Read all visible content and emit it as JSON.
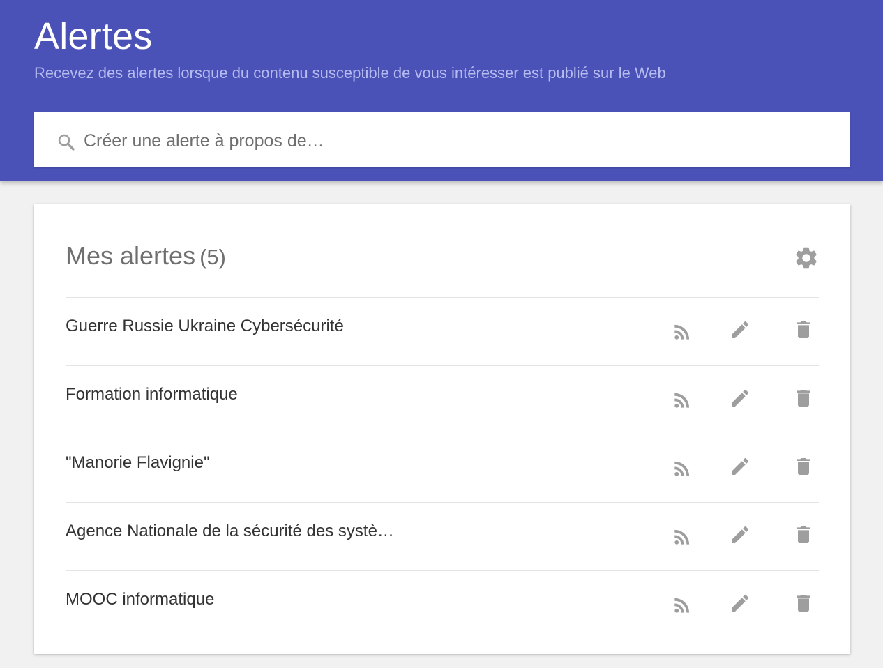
{
  "header": {
    "title": "Alertes",
    "subtitle": "Recevez des alertes lorsque du contenu susceptible de vous intéresser est publié sur le Web"
  },
  "search": {
    "icon": "search-icon",
    "placeholder": "Créer une alerte à propos de…"
  },
  "alerts_card": {
    "title": "Mes alertes",
    "count": "(5)",
    "settings_icon": "gear-icon",
    "items": [
      {
        "label": "Guerre Russie Ukraine Cybersécurité"
      },
      {
        "label": "Formation informatique"
      },
      {
        "label": "\"Manorie Flavignie\""
      },
      {
        "label": "Agence Nationale de la sécurité des systè…"
      },
      {
        "label": "MOOC informatique"
      }
    ],
    "row_icons": [
      "rss-icon",
      "edit-icon",
      "delete-icon"
    ]
  },
  "colors": {
    "header_bg": "#4a51b7",
    "subtitle": "#b6bcf0",
    "icon_gray": "#9e9e9e",
    "page_bg": "#f1f1f1"
  }
}
